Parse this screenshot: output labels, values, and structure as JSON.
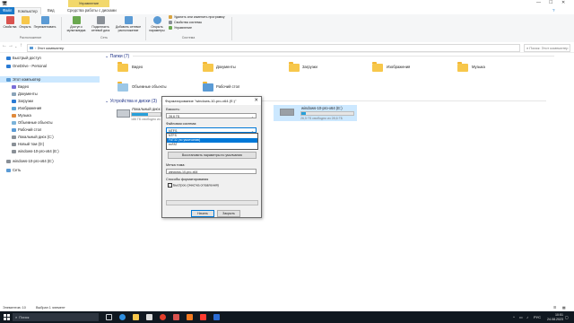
{
  "titlebar": {
    "manage_tab": "Управление",
    "tabs": [
      "Файл",
      "Компьютер",
      "Вид",
      "Средства работы с дисками"
    ]
  },
  "ribbon": {
    "groups": [
      "Расположение",
      "Сеть",
      "Система"
    ],
    "buttons": [
      "Свойства",
      "Открыть",
      "Переименовать",
      "Доступ к мультимедиа",
      "Подключить сетевой диск",
      "Добавить сетевое расположение",
      "Открыть параметры"
    ],
    "system_lines": [
      "Удалить или изменить программу",
      "Свойства системы",
      "Управление"
    ]
  },
  "addressbar": {
    "path": "Этот компьютер",
    "search_placeholder": "Поиск: Этот компьютер"
  },
  "navpane": {
    "items": [
      {
        "label": "Быстрый доступ",
        "icon": "star-icon",
        "color": "#2a7bd4"
      },
      {
        "label": "OneDrive - Personal",
        "icon": "cloud-icon",
        "color": "#2a7bd4"
      },
      {
        "label": "Этот компьютер",
        "icon": "computer-icon",
        "color": "#5b9bd5"
      },
      {
        "label": "Видео",
        "icon": "video-folder-icon",
        "color": "#7a6ed8"
      },
      {
        "label": "Документы",
        "icon": "documents-folder-icon",
        "color": "#8aa3b8"
      },
      {
        "label": "Загрузки",
        "icon": "downloads-folder-icon",
        "color": "#2a7bd4"
      },
      {
        "label": "Изображения",
        "icon": "pictures-folder-icon",
        "color": "#5ba3d5"
      },
      {
        "label": "Музыка",
        "icon": "music-folder-icon",
        "color": "#e08a3b"
      },
      {
        "label": "Объемные объекты",
        "icon": "3d-objects-icon",
        "color": "#7bb3d9"
      },
      {
        "label": "Рабочий стол",
        "icon": "desktop-folder-icon",
        "color": "#5b9bd5"
      },
      {
        "label": "Локальный диск (C:)",
        "icon": "drive-icon",
        "color": "#8a9097"
      },
      {
        "label": "Новый том (D:)",
        "icon": "drive-icon",
        "color": "#8a9097"
      },
      {
        "label": "windows-10-pro-x64 (E:)",
        "icon": "usb-drive-icon",
        "color": "#8a9097"
      },
      {
        "label": "windows-10-pro-x64 (E:)",
        "icon": "usb-drive-icon",
        "color": "#8a9097"
      },
      {
        "label": "Сеть",
        "icon": "network-icon",
        "color": "#5b9bd5"
      }
    ]
  },
  "content": {
    "folders_header": "Папки (7)",
    "folders": [
      "Видео",
      "Документы",
      "Загрузки",
      "Изображения",
      "Музыка",
      "Объемные объекты",
      "Рабочий стол"
    ],
    "devices_header": "Устройства и диски (3)",
    "drives": [
      {
        "name": "Локальный диск (C:)",
        "space": "186 ГБ свободно из ...",
        "used_fraction": 0.55
      },
      {
        "name": "windows-10-pro-x64 (E:)",
        "space": "26,5 ГБ свободно из 28,6 ГБ",
        "used_fraction": 0.08
      }
    ]
  },
  "dialog": {
    "title": "Форматирование \"windows-10-pro-x64 (E:)\"",
    "capacity_label": "Емкость:",
    "capacity_value": "28,6 ГБ",
    "fs_label": "Файловая система:",
    "fs_value": "NTFS",
    "fs_options": [
      "NTFS",
      "FAT32 (по умолчанию)",
      "exFAT"
    ],
    "restore_button": "Восстановить параметры по умолчанию",
    "volume_label": "Метка тома:",
    "volume_value": "windows-10-pro-x64",
    "methods_label": "Способы форматирования",
    "quick_format": "Быстрое (очистка оглавления)",
    "start_button": "Начать",
    "close_button": "Закрыть"
  },
  "statusbar": {
    "items": "Элементов: 10",
    "selected": "Выбран 1 элемент"
  },
  "taskbar": {
    "search_placeholder": "Поиск",
    "time": "10:51",
    "date": "24.08.2023",
    "lang": "РУС"
  }
}
